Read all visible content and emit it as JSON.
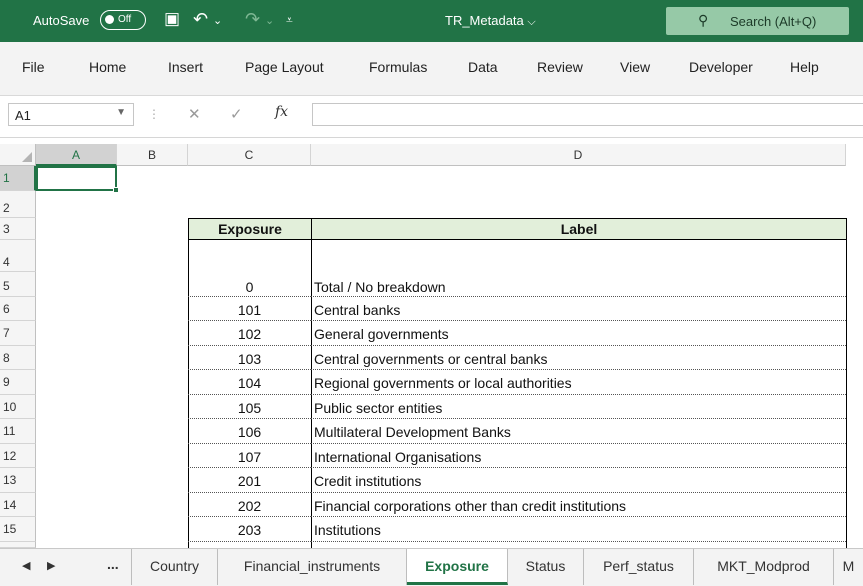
{
  "titlebar": {
    "autosave_label": "AutoSave",
    "autosave_state": "Off",
    "filename": "TR_Metadata",
    "filename_caret": "⌵",
    "search_placeholder": "Search (Alt+Q)",
    "save_icon": "▣",
    "undo_icon": "↶",
    "undo_caret": "⌄",
    "redo_icon": "↷",
    "redo_caret": "⌄",
    "customize_icon": "⩡",
    "search_icon": "⚲"
  },
  "menu": [
    "File",
    "Home",
    "Insert",
    "Page Layout",
    "Formulas",
    "Data",
    "Review",
    "View",
    "Developer",
    "Help"
  ],
  "formulabar": {
    "namebox": "A1",
    "namebox_caret": "▼",
    "dots": "⋮",
    "cancel": "✕",
    "enter": "✓",
    "fx": "fx",
    "value": ""
  },
  "columns": [
    "A",
    "B",
    "C",
    "D"
  ],
  "rows": [
    "1",
    "2",
    "3",
    "4",
    "5",
    "6",
    "7",
    "8",
    "9",
    "10",
    "11",
    "12",
    "13",
    "14",
    "15"
  ],
  "table": {
    "header_code": "Exposure",
    "header_label": "Label",
    "entries": [
      {
        "code": "0",
        "label": "Total / No breakdown"
      },
      {
        "code": "101",
        "label": "Central banks"
      },
      {
        "code": "102",
        "label": "General governments"
      },
      {
        "code": "103",
        "label": "Central governments or central banks"
      },
      {
        "code": "104",
        "label": "Regional governments or local authorities"
      },
      {
        "code": "105",
        "label": "Public sector entities"
      },
      {
        "code": "106",
        "label": "Multilateral Development Banks"
      },
      {
        "code": "107",
        "label": "International Organisations"
      },
      {
        "code": "201",
        "label": "Credit institutions"
      },
      {
        "code": "202",
        "label": "Financial corporations other than credit institutions"
      },
      {
        "code": "203",
        "label": "Institutions"
      }
    ]
  },
  "sheets": {
    "nav_prev": "◀",
    "nav_next": "▶",
    "nav_more": "...",
    "tabs": [
      "Country",
      "Financial_instruments",
      "Exposure",
      "Status",
      "Perf_status",
      "MKT_Modprod",
      "M"
    ],
    "active": "Exposure"
  },
  "colors": {
    "accent": "#217346",
    "header_fill": "#e2efda"
  }
}
